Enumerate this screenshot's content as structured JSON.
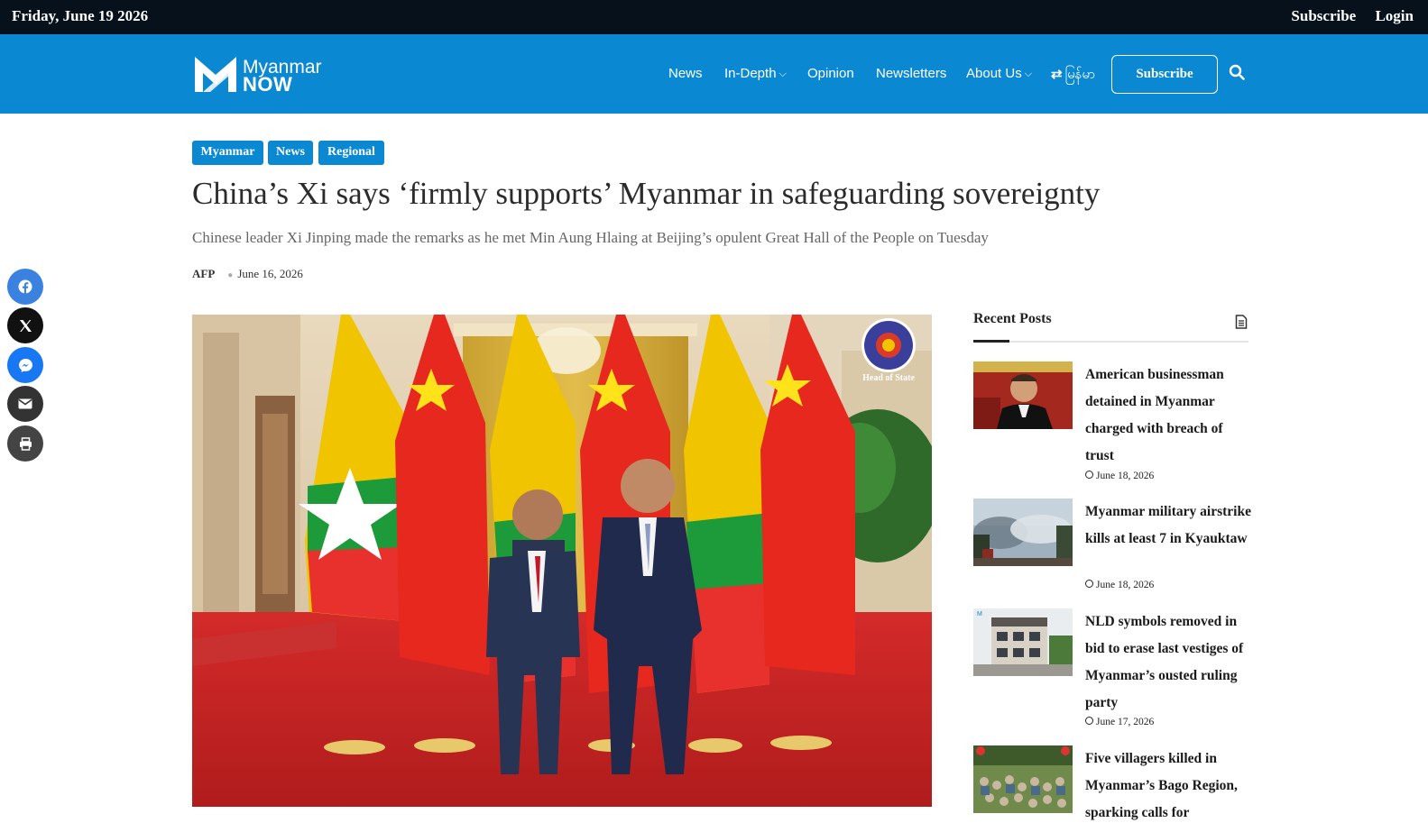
{
  "topbar": {
    "date": "Friday, June 19 2026",
    "subscribe": "Subscribe",
    "login": "Login"
  },
  "header": {
    "logo_line1": "Myanmar",
    "logo_line2": "NOW",
    "nav": {
      "news": "News",
      "in_depth": "In-Depth",
      "opinion": "Opinion",
      "newsletters": "Newsletters",
      "about": "About Us",
      "language": "မြန်မာ"
    },
    "subscribe_button": "Subscribe"
  },
  "article": {
    "tags": [
      "Myanmar",
      "News",
      "Regional"
    ],
    "title": "China’s Xi says ‘firmly supports’ Myanmar in safeguarding sovereignty",
    "subtitle": "Chinese leader Xi Jinping made the remarks as he met Min Aung Hlaing at Beijing’s opulent Great Hall of the People on Tuesday",
    "author": "AFP",
    "date": "June 16, 2026",
    "image_watermark": "Head of State"
  },
  "share": [
    "facebook-icon",
    "x-icon",
    "messenger-icon",
    "email-icon",
    "print-icon"
  ],
  "sidebar": {
    "title": "Recent Posts",
    "posts": [
      {
        "title": "American businessman detained in Myanmar charged with breach of trust",
        "date": "June 18, 2026"
      },
      {
        "title": "Myanmar military airstrike kills at least 7 in Kyauktaw",
        "date": "June 18, 2026"
      },
      {
        "title": "NLD symbols removed in bid to erase last vestiges of Myanmar’s ousted ruling party",
        "date": "June 17, 2026"
      },
      {
        "title": "Five villagers killed in Myanmar’s Bago Region, sparking calls for",
        "date": ""
      }
    ]
  },
  "colors": {
    "brand_blue": "#0b88d2",
    "topbar": "#06111c"
  }
}
